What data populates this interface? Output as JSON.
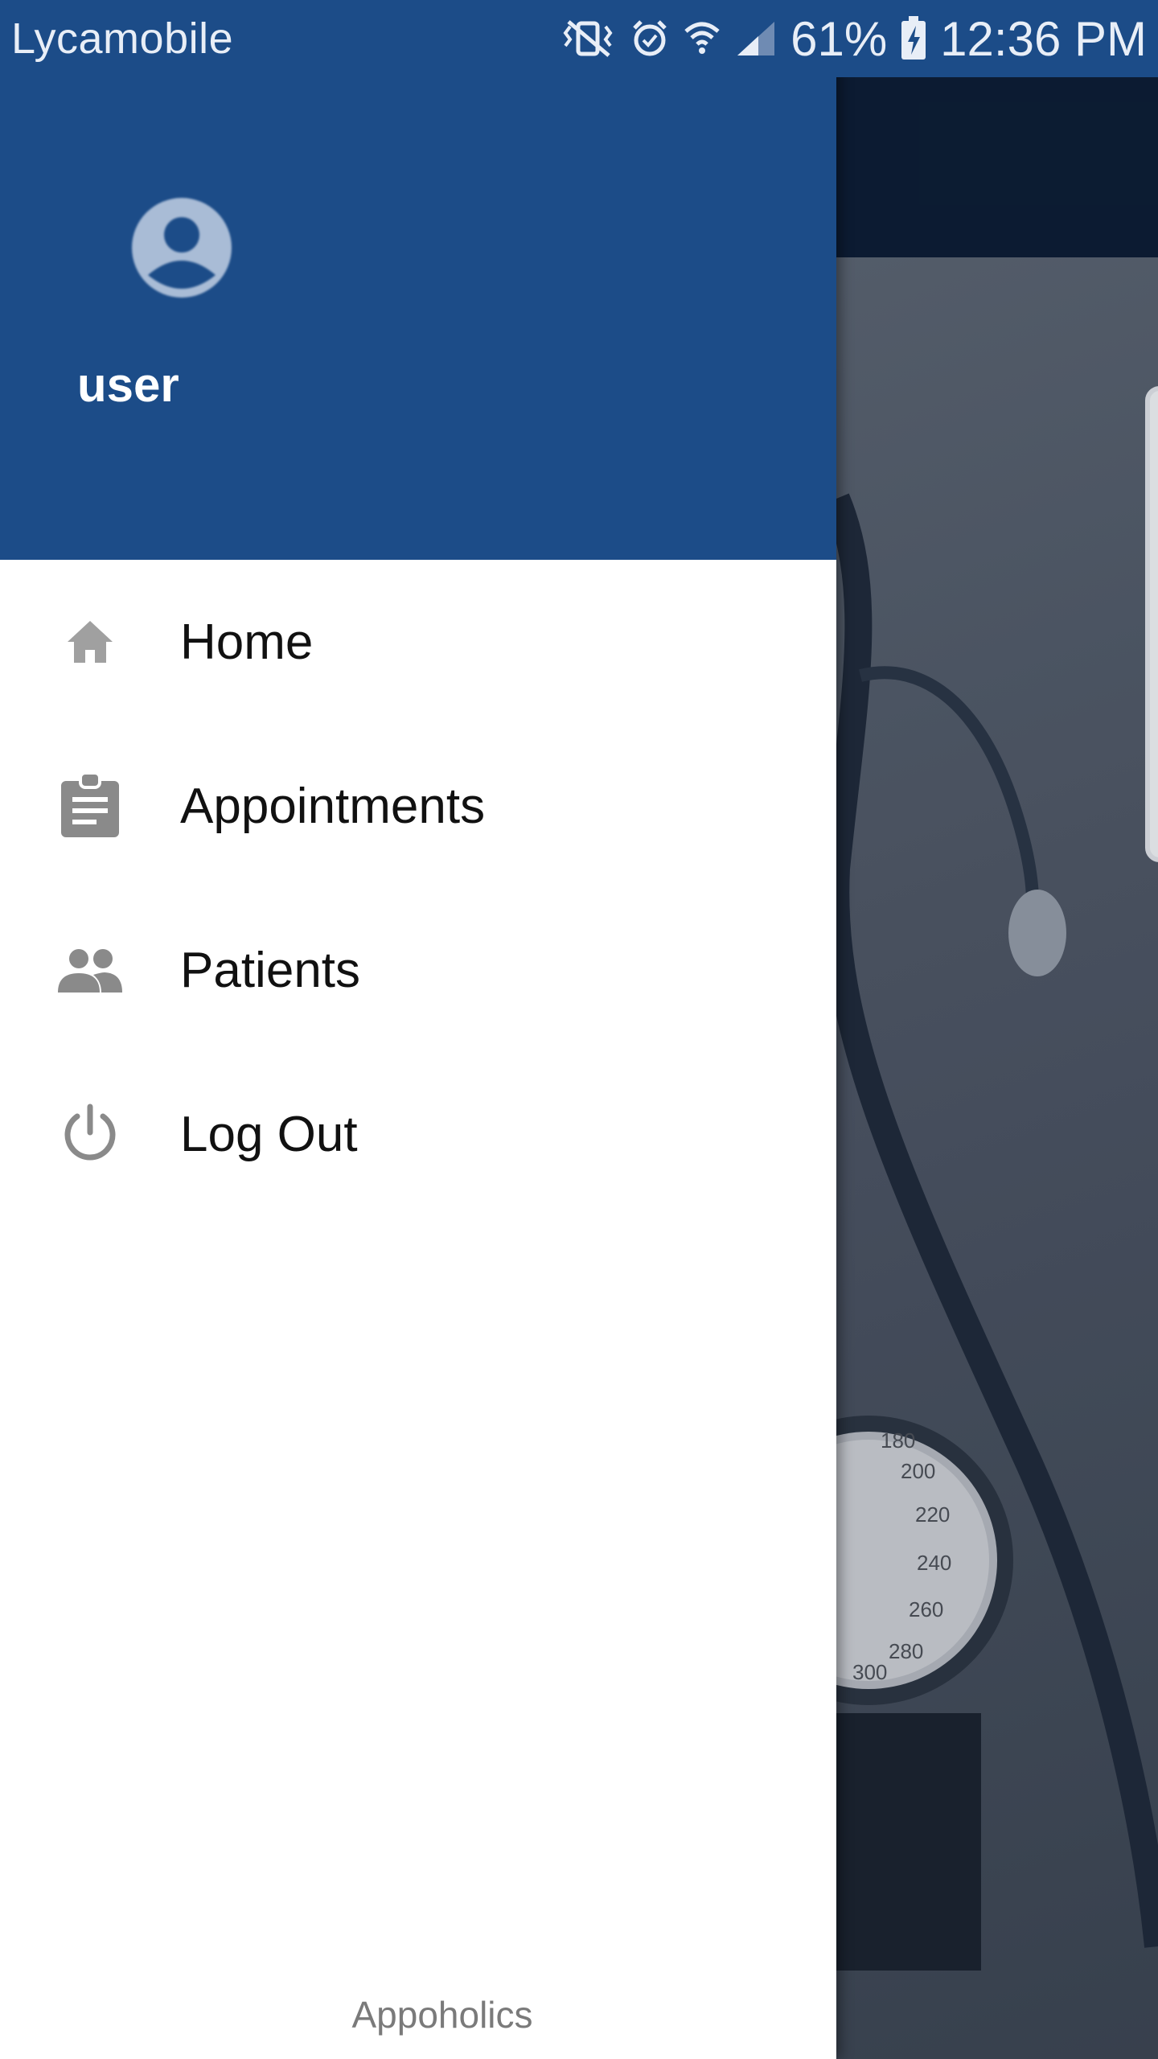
{
  "status_bar": {
    "carrier": "Lycamobile",
    "battery": "61%",
    "time": "12:36 PM",
    "icons": [
      "vibrate-icon",
      "alarm-icon",
      "wifi-icon",
      "signal-icon",
      "battery-icon"
    ]
  },
  "drawer": {
    "username": "user",
    "avatar_icon": "account-circle-icon",
    "menu": [
      {
        "label": "Home",
        "icon": "home-icon"
      },
      {
        "label": "Appointments",
        "icon": "clipboard-icon"
      },
      {
        "label": "Patients",
        "icon": "people-icon"
      },
      {
        "label": "Log Out",
        "icon": "power-icon"
      }
    ],
    "footer": "Appoholics"
  },
  "colors": {
    "header_blue": "#1c4c88",
    "toolbar_dark": "#0d1d35",
    "icon_grey": "#8a8a8a"
  }
}
